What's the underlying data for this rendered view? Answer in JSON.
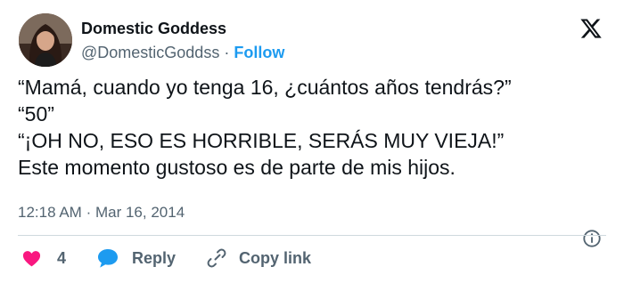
{
  "author": {
    "display_name": "Domestic Goddess",
    "handle": "@DomesticGoddss",
    "separator": "·",
    "follow_label": "Follow"
  },
  "tweet": {
    "lines": [
      "“Mamá, cuando yo tenga 16, ¿cuántos años tendrás?”",
      "“50”",
      "“¡OH NO, ESO ES HORRIBLE, SERÁS MUY VIEJA!”",
      "Este momento gustoso es de parte de mis hijos."
    ],
    "time": "12:18 AM",
    "separator": "·",
    "date": "Mar 16, 2014"
  },
  "actions": {
    "like_count": "4",
    "reply_label": "Reply",
    "copy_label": "Copy link"
  },
  "icons": {
    "platform": "x-logo-icon",
    "info": "info-icon",
    "like": "heart-icon",
    "reply": "speech-bubble-icon",
    "copy": "link-icon"
  },
  "colors": {
    "text": "#0f1419",
    "muted": "#536471",
    "follow": "#1d9bf0",
    "heart": "#f91880",
    "reply": "#1d9bf0",
    "divider": "#cfd9de"
  }
}
